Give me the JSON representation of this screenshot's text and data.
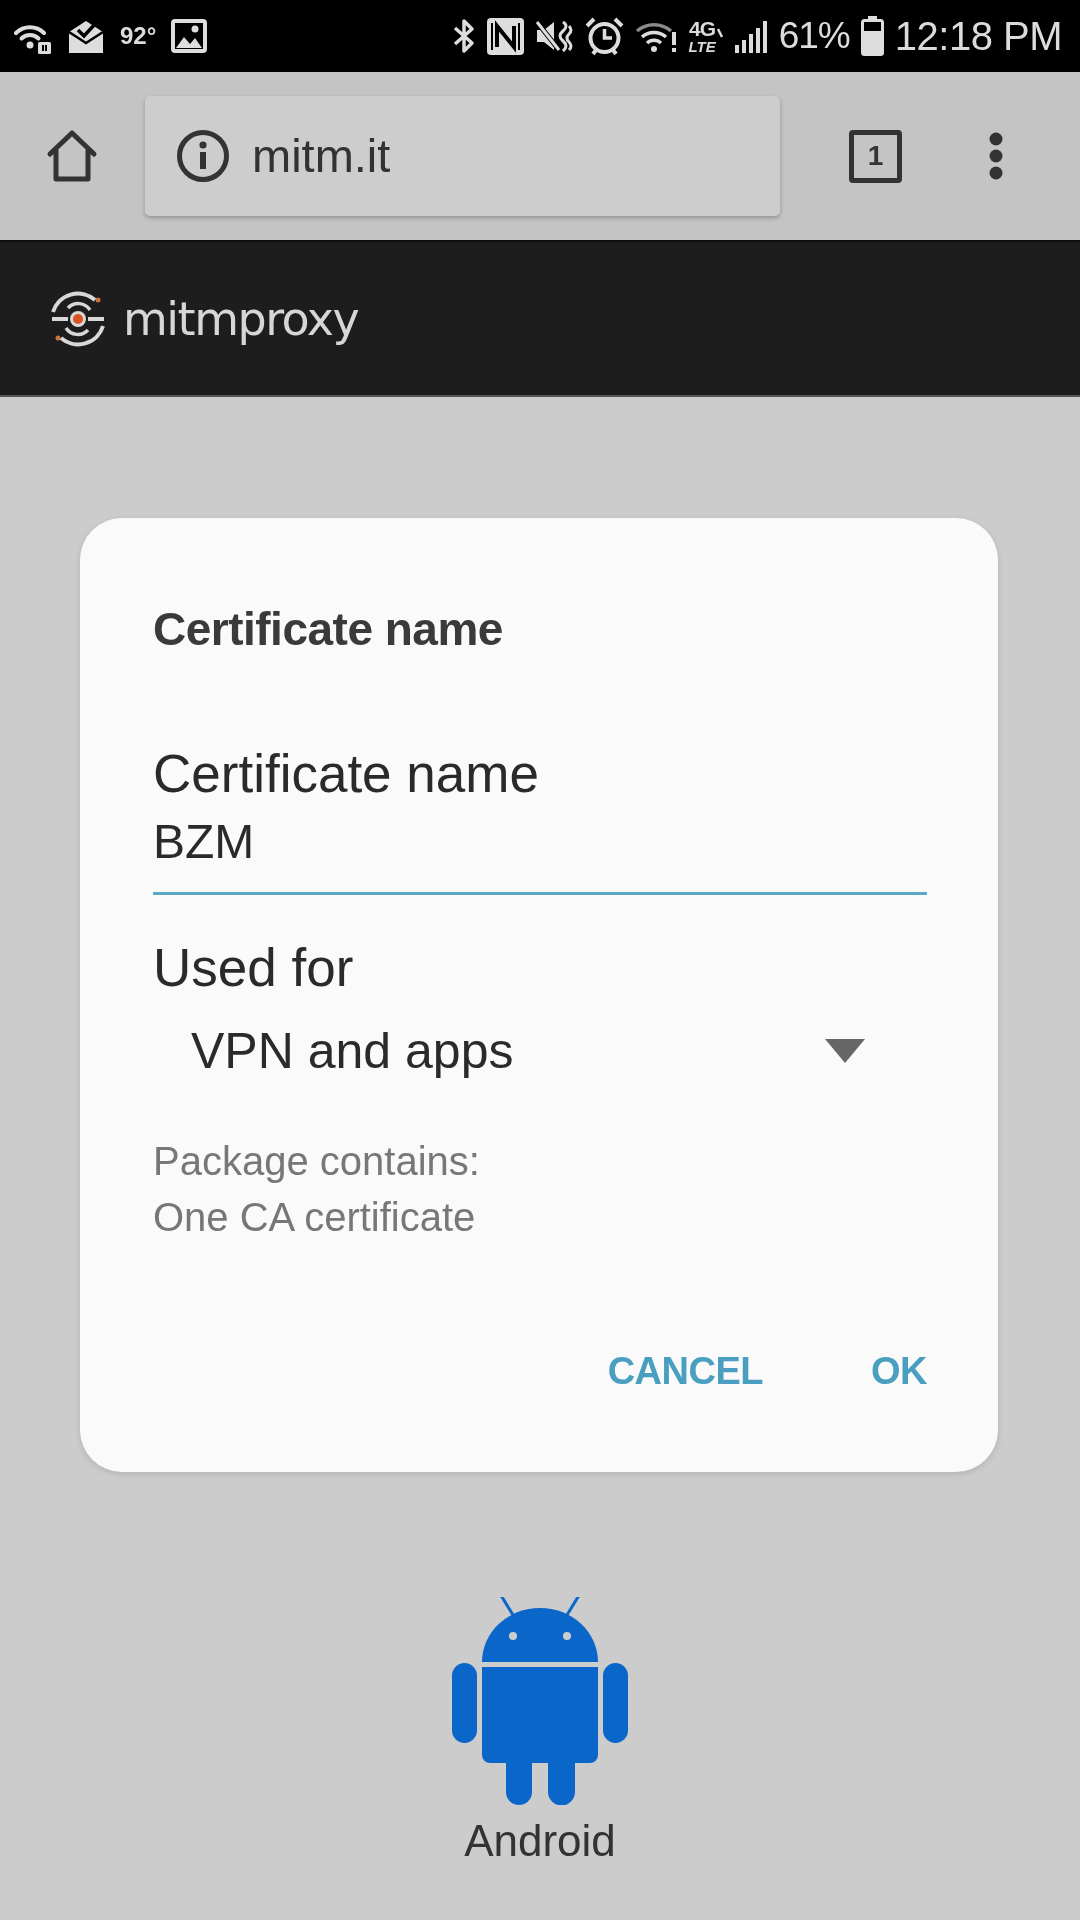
{
  "status_bar": {
    "temperature": "92°",
    "network_type": "4G",
    "network_subtype": "LTE",
    "battery_percent": "61%",
    "time": "12:18 PM"
  },
  "browser_toolbar": {
    "url": "mitm.it",
    "tab_count": "1"
  },
  "site_header": {
    "logo_text": "mitmproxy"
  },
  "dialog": {
    "title": "Certificate name",
    "fields": [
      {
        "kind": "text",
        "label": "Certificate name",
        "value": "BZM",
        "focused": true
      },
      {
        "kind": "dropdown",
        "label": "Used for",
        "value": "VPN and apps"
      }
    ],
    "info": [
      "Package contains:",
      "One CA certificate"
    ],
    "buttons": [
      "CANCEL",
      "OK"
    ]
  },
  "page": {
    "platforms": [
      {
        "label": "Android"
      }
    ]
  }
}
